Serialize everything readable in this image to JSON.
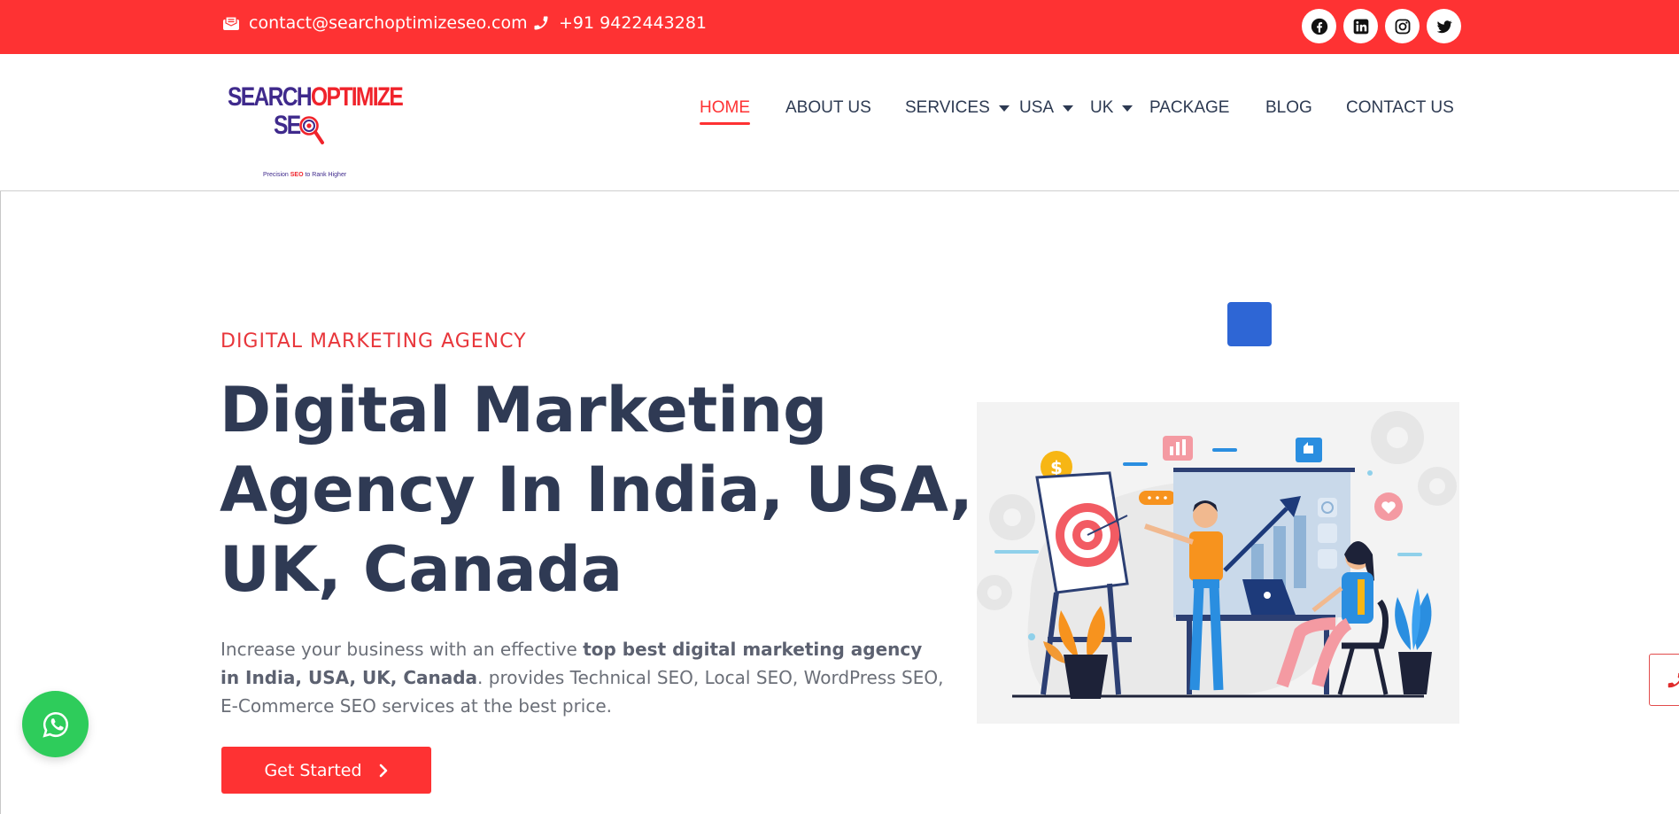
{
  "topbar": {
    "email": "contact@searchoptimizeseo.com",
    "phone": "+91 9422443281",
    "socials": [
      "facebook-icon",
      "linkedin-icon",
      "instagram-icon",
      "twitter-icon"
    ]
  },
  "logo": {
    "line1a": "SEARCH",
    "line1b": "OPTIMIZE",
    "line2": "SE",
    "tagline_pre": "Precision ",
    "tagline_bold": "SEO",
    "tagline_post": " to Rank Higher"
  },
  "nav": {
    "home": "HOME",
    "about": "ABOUT US",
    "services": "SERVICES",
    "usa": "USA",
    "uk": "UK",
    "package": "PACKAGE",
    "blog": "BLOG",
    "contact": "CONTACT US"
  },
  "hero": {
    "eyebrow": "DIGITAL MARKETING AGENCY",
    "headline_line1": "Digital Marketing",
    "headline_line2": "Agency In India, USA,",
    "headline_line3": "UK, Canada",
    "desc_pre": "Increase your business with an effective ",
    "desc_bold": "top best digital marketing agency in India, USA, UK, Canada",
    "desc_post": ". provides Technical SEO, Local SEO, WordPress SEO, E-Commerce SEO services at the best price.",
    "cta": "Get Started"
  },
  "colors": {
    "brand_red": "#fe3233",
    "navy": "#2f3a54",
    "whatsapp": "#2ecc5b",
    "accent_blue": "#2e66d5"
  }
}
